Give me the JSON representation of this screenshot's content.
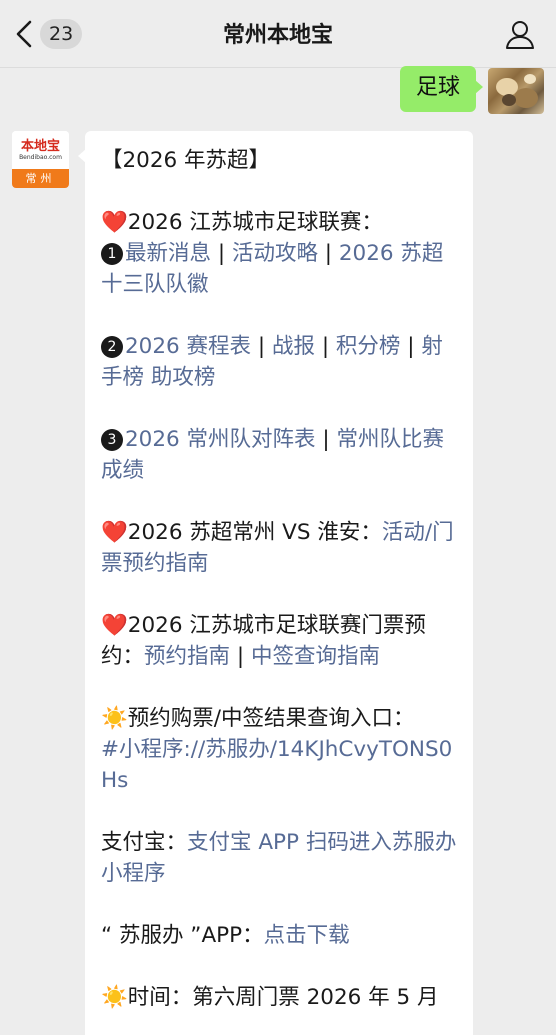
{
  "header": {
    "title": "常州本地宝",
    "unread_count": "23"
  },
  "colors": {
    "link": "#576b95",
    "sent_bubble": "#95ec69",
    "heart": "#e0303a",
    "background": "#ededed"
  },
  "icons": {
    "back": "chevron-left-icon",
    "profile": "person-icon",
    "heart": "heart-icon",
    "number_badges": [
      "circled-1-icon",
      "circled-2-icon",
      "circled-3-icon"
    ],
    "sun": "sun-icon"
  },
  "sent_message": {
    "text": "足球"
  },
  "bot_avatar": {
    "name_cn": "本地宝",
    "name_en": "Bendibao.com",
    "city": "常州"
  },
  "reply": {
    "heading": "【2026 年苏超】",
    "section1": {
      "title": "2026 江苏城市足球联赛：",
      "num": "❶",
      "links": [
        "最新消息",
        "活动攻略",
        "2026 苏超十三队队徽"
      ],
      "sep": " | "
    },
    "section2": {
      "num": "❷",
      "links": [
        "2026 赛程表",
        "战报",
        "积分榜",
        "射手榜 助攻榜"
      ],
      "sep": " | "
    },
    "section3": {
      "num": "❸",
      "links": [
        "2026 常州队对阵表",
        "常州队比赛成绩"
      ],
      "sep": " | "
    },
    "section4": {
      "label": "2026 苏超常州 VS 淮安：",
      "link": "活动/门票预约指南"
    },
    "section5": {
      "label": "2026 江苏城市足球联赛门票预约：",
      "links": [
        "预约指南",
        "中签查询指南"
      ],
      "sep": " | "
    },
    "section6": {
      "label": "预约购票/中签结果查询入口：",
      "link": "#小程序://苏服办/14KJhCvyTONS0Hs"
    },
    "section7": {
      "label": "支付宝：",
      "link": "支付宝 APP 扫码进入苏服办小程序"
    },
    "section8": {
      "label": "“ 苏服办 ”APP：",
      "link": "点击下载"
    },
    "section9": {
      "label": "时间：第六周门票 2026 年 5 月"
    }
  }
}
